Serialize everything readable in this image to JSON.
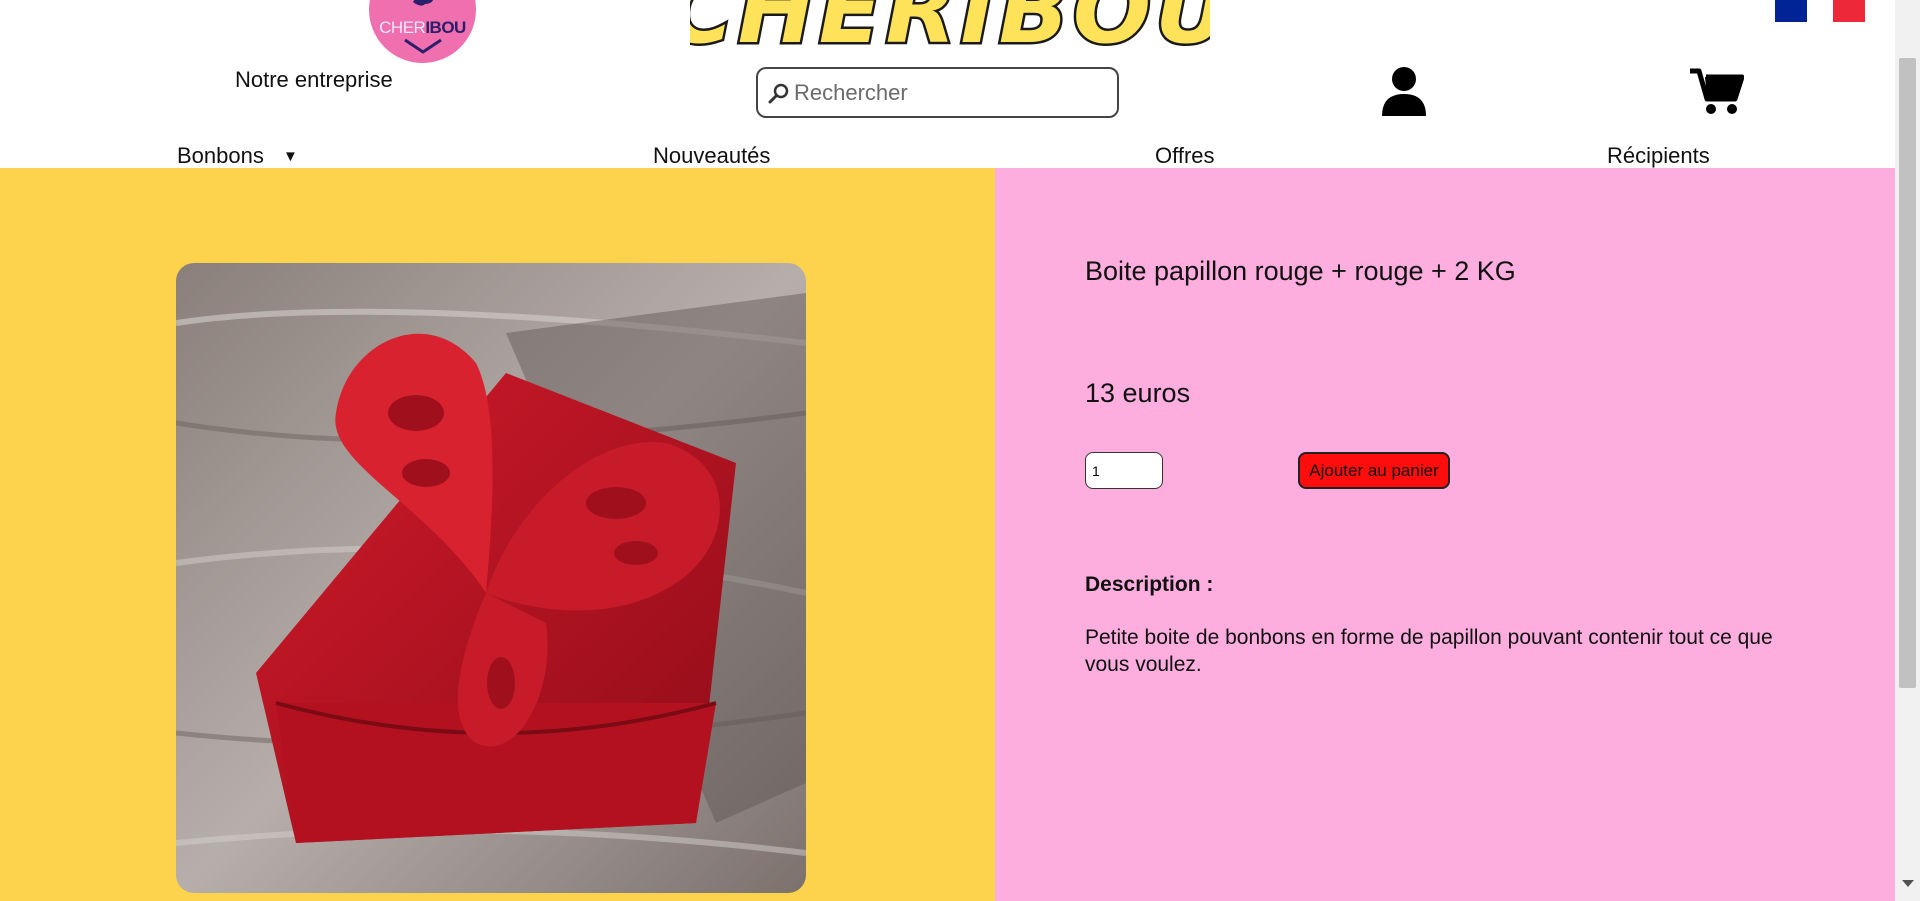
{
  "header": {
    "logo_text_light": "CHER",
    "logo_text_bold": "IBOU",
    "brand_title": "CHERIBOU",
    "company_link": "Notre entreprise",
    "search": {
      "placeholder": "Rechercher",
      "value": ""
    },
    "account_icon": "user-icon",
    "cart_icon": "shopping-cart-icon",
    "flags": [
      "flag-fr",
      "flag-fr"
    ]
  },
  "nav": {
    "items": [
      {
        "label": "Bonbons",
        "has_dropdown": true
      },
      {
        "label": "Nouveautés"
      },
      {
        "label": "Offres"
      },
      {
        "label": "Récipients"
      }
    ],
    "dropdown_caret": "▼"
  },
  "product": {
    "name": "Boite papillon rouge + rouge + 2 KG",
    "price": "13 euros",
    "quantity": "1",
    "add_to_cart_label": "Ajouter au panier",
    "description_heading": "Description :",
    "description": "Petite boite de bonbons en forme de papillon pouvant contenir tout ce que vous voulez."
  },
  "colors": {
    "left_panel": "#fdd24c",
    "right_panel": "#fdaedf",
    "add_button": "#ff0d0d",
    "logo_badge": "#f06fae",
    "brand_title_fill": "#fde25a"
  }
}
